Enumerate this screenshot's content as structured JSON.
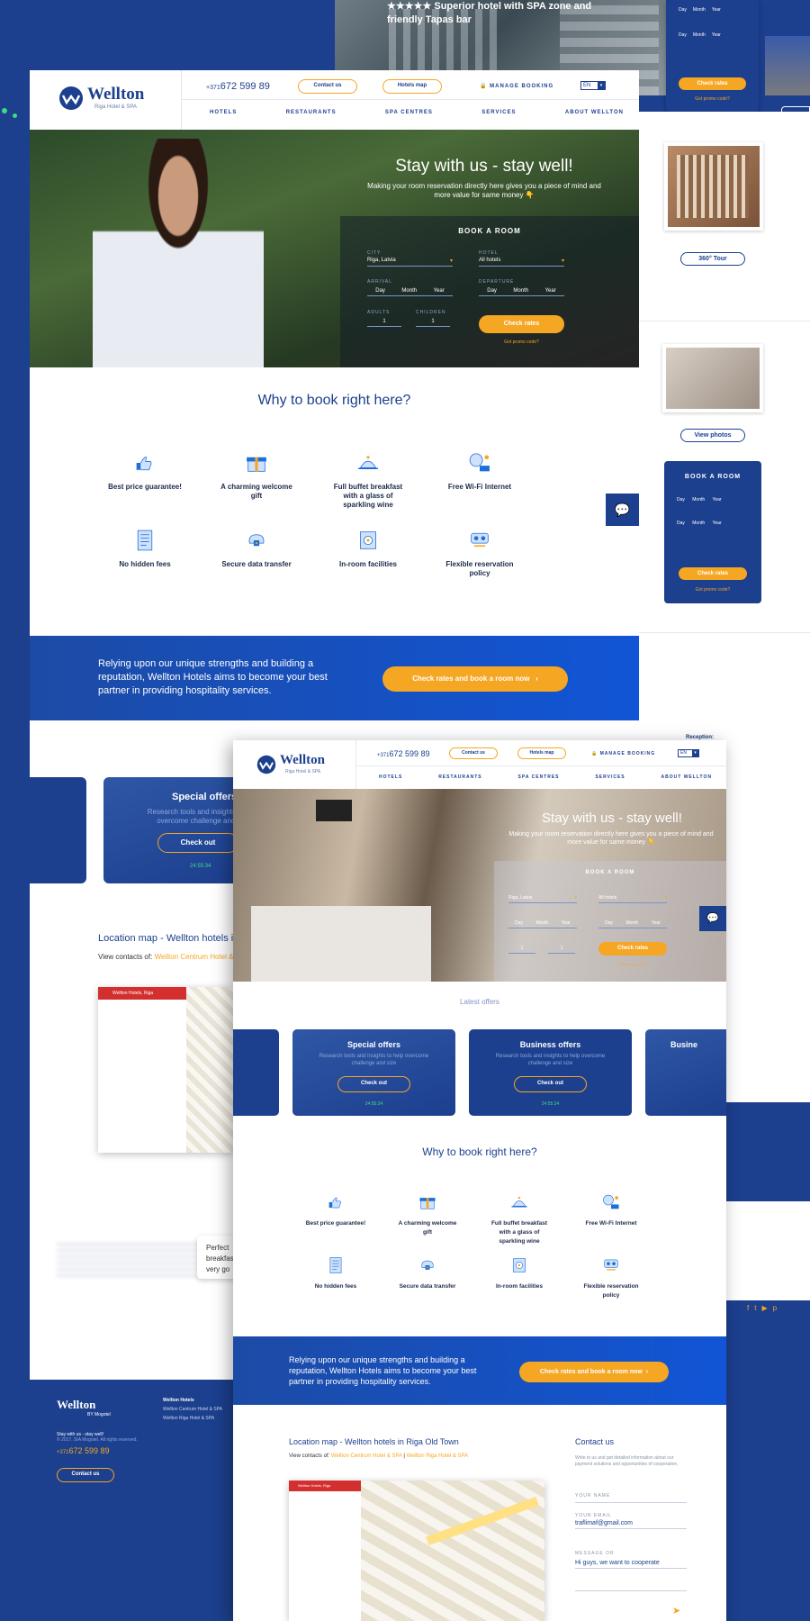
{
  "bg_top_right": {
    "headline": "★★★★★ Superior hotel with SPA zone and friendly Tapas bar"
  },
  "mini_booking": {
    "labels": [
      "Day",
      "Month",
      "Year"
    ],
    "check": "Check rates",
    "promo": "Got promo code?",
    "title": "BOOK A ROOM"
  },
  "right_col": {
    "tour_btn": "360° Tour",
    "photos_btn": "View photos"
  },
  "header": {
    "brand": "Wellton",
    "brand_sub": "Riga Hotel & SPA",
    "phone_prefix": "+371",
    "phone": "672 599 89",
    "contact_btn": "Contact us",
    "map_btn": "Hotels map",
    "manage": "MANAGE BOOKING",
    "lang": "EN",
    "nav": [
      "HOTELS",
      "RESTAURANTS",
      "SPA CENTRES",
      "SERVICES",
      "ABOUT WELLTON"
    ]
  },
  "hero": {
    "title": "Stay with us - stay well!",
    "subtitle": "Making your room reservation directly here gives you a piece of mind and more value for same money 👇",
    "book_title": "BOOK A ROOM",
    "city_label": "CITY",
    "city": "Riga, Latvia",
    "hotel_label": "HOTEL",
    "hotel": "All hotels",
    "arrival": "ARRIVAL",
    "departure": "DEPARTURE",
    "adults": "ADULTS",
    "children": "CHILDREN",
    "adults_val": "1",
    "children_val": "1",
    "day": "Day",
    "month": "Month",
    "year": "Year",
    "check": "Check rates",
    "promo": "Got promo code?"
  },
  "why": {
    "title": "Why to book right here?",
    "items": [
      "Best price guarantee!",
      "A charming welcome gift",
      "Full buffet breakfast with a glass of sparkling wine",
      "Free Wi-Fi Internet",
      "No hidden fees",
      "Secure data transfer",
      "In-room facilities",
      "Flexible reservation policy"
    ]
  },
  "banner": {
    "text": "Relying upon our unique strengths and building a reputation, Wellton Hotels aims to become your best partner in providing hospitality services.",
    "cta": "Check rates and book a room now"
  },
  "offers": {
    "latest": "Latest offers",
    "cards": [
      {
        "title": "Special offers",
        "desc": "Research tools and insights to help overcome challenge and size",
        "btn": "Check out",
        "timer": "24:55:34"
      },
      {
        "title": "Business offers",
        "desc": "Research tools and insights to help overcome challenge and size",
        "btn": "Check out",
        "timer": "24:55:34"
      }
    ],
    "peek_title": "Busine"
  },
  "location": {
    "title_left": "Location map - Wellton hotels i",
    "title": "Location map - Wellton hotels in Riga Old Town",
    "contacts_prefix": "View contacts of:",
    "contact1": "Wellton Centrum Hotel & SPA",
    "contact2": "Wellton Riga Hotel & SPA",
    "map_header": "Wellton Hotels, Riga"
  },
  "contact_form": {
    "title": "Contact us",
    "desc": "Write to us and get detailed information about our payment solutions and opportunities of cooperation.",
    "name_label": "YOUR NAME",
    "email_label": "YOUR EMAIL",
    "email": "traflimaf@gmail.com",
    "msg_label": "MESSAGE OR",
    "msg": "Hi guys, we want to cooperate"
  },
  "right_partial": {
    "reception": "Reception:",
    "social": [
      "f",
      "t",
      "▶",
      "p"
    ]
  },
  "footer": {
    "brand": "Wellton",
    "by": "BY Mogotel",
    "slogan": "Stay with us - stay well!",
    "copy": "© 2017, SIA Mogotel. All rights reserved.",
    "phone_prefix": "+371",
    "phone": "672 599 89",
    "contact_btn": "Contact us",
    "hotels_title": "Wellton Hotels",
    "hotels": [
      "Wellton Centrum Hotel & SPA",
      "Wellton Riga Hotel & SPA"
    ]
  },
  "review": {
    "text": "Perfect breakfast very go"
  }
}
